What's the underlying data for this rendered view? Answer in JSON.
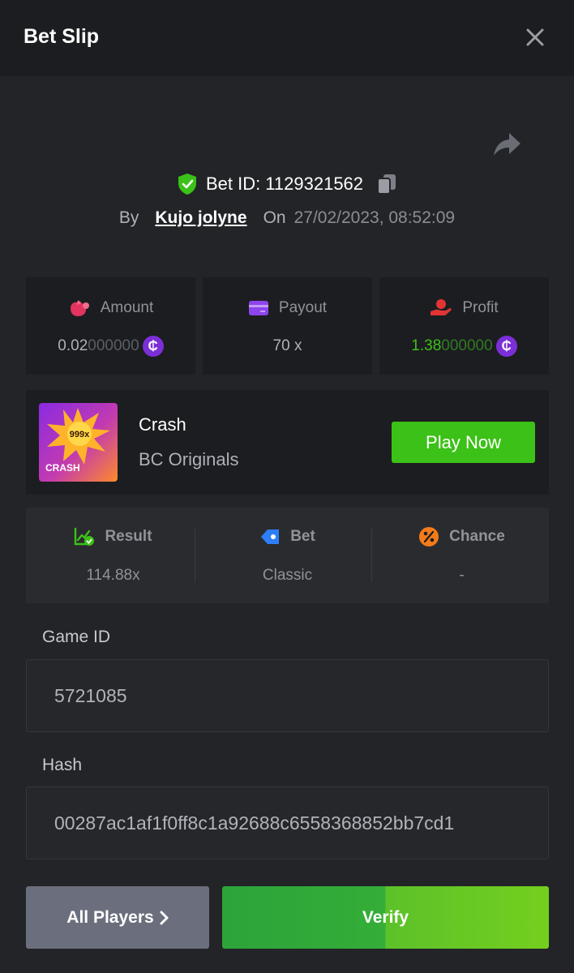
{
  "header": {
    "title": "Bet Slip",
    "close_icon": "close-icon"
  },
  "share_icon": "share-icon",
  "bet": {
    "id_text": "Bet ID: 1129321562",
    "by_label": "By",
    "user": "Kujo jolyne",
    "on_label": "On",
    "datetime": "27/02/2023, 08:52:09"
  },
  "stats": {
    "amount": {
      "label": "Amount",
      "value_main": "0.02",
      "value_dim": "000000",
      "icon": "money-bag-icon"
    },
    "payout": {
      "label": "Payout",
      "value": "70 x",
      "icon": "credit-card-icon"
    },
    "profit": {
      "label": "Profit",
      "value_main": "1.38",
      "value_dim": "000000",
      "icon": "hand-coin-icon"
    },
    "coin_symbol": "₵"
  },
  "game": {
    "thumb_badge": "999x",
    "thumb_label": "CRASH",
    "name": "Crash",
    "provider": "BC Originals",
    "play_label": "Play Now"
  },
  "details": {
    "result": {
      "label": "Result",
      "value": "114.88x"
    },
    "bet": {
      "label": "Bet",
      "value": "Classic"
    },
    "chance": {
      "label": "Chance",
      "value": "-"
    }
  },
  "game_id": {
    "label": "Game ID",
    "value": "5721085"
  },
  "hash": {
    "label": "Hash",
    "value": "00287ac1af1f0ff8c1a92688c6558368852bb7cd1"
  },
  "actions": {
    "all_players": "All Players",
    "verify": "Verify"
  },
  "colors": {
    "accent_green": "#3bc117",
    "coin_purple": "#7b2fd6",
    "background": "#232427"
  }
}
